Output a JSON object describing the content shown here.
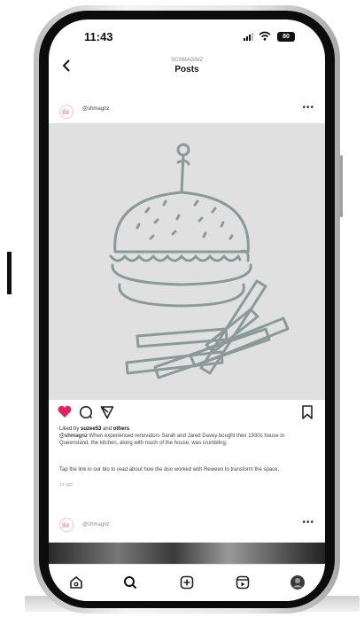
{
  "status_bar": {
    "time": "11:43",
    "signal": "▮▮▮",
    "battery": "80"
  },
  "header": {
    "subtitle": "SCHMAGNIZ",
    "title": "Posts",
    "back_icon": "chevron-left-icon"
  },
  "post": {
    "username": "@shmagnz",
    "more_icon": "more-horizontal-icon",
    "image_subject": "burger-and-fries-illustration",
    "colors": {
      "illustration_stroke": "#8a9a98",
      "photo_bg": "#e0e0e0",
      "like": "#e0245e"
    },
    "liked_by_prefix": "Liked by",
    "liked_by_user": "suzee53",
    "liked_by_suffix": "and",
    "liked_by_others": "others",
    "caption_user": "@shmagnz",
    "caption": "When experienced renovators Sarah and Jared Davey bought their 1930s house in Queensland, the kitchen, along with much of the house, was crumbling.",
    "caption_more": "Tap the link in our bio to read about how the duo worked with Reween to transform the space.",
    "time_ago": "1d ago"
  },
  "next_post": {
    "username": "@shmagnz"
  },
  "nav": {
    "items": [
      {
        "name": "home",
        "icon": "home-icon"
      },
      {
        "name": "search",
        "icon": "search-icon"
      },
      {
        "name": "create",
        "icon": "plus-square-icon"
      },
      {
        "name": "reels",
        "icon": "reels-icon"
      },
      {
        "name": "profile",
        "icon": "avatar-icon"
      }
    ]
  }
}
